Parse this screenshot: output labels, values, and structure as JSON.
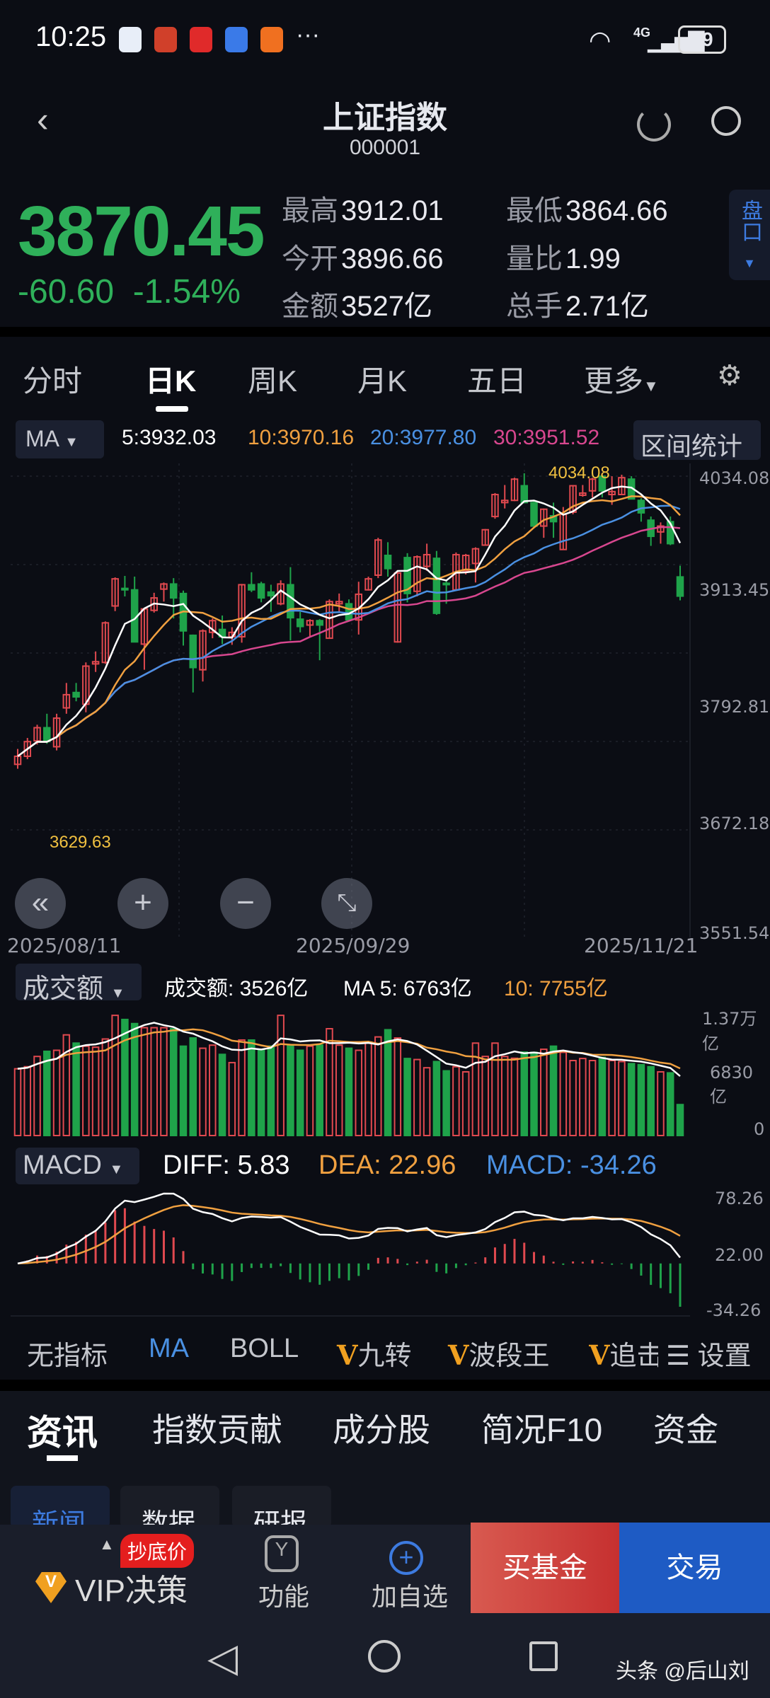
{
  "status_bar": {
    "time": "10:25",
    "more": "···",
    "network": "4G",
    "battery": "99"
  },
  "header": {
    "title": "上证指数",
    "code": "000001"
  },
  "quote": {
    "price": "3870.45",
    "change": "-60.60",
    "change_pct": "-1.54%",
    "stats": [
      {
        "label": "最高",
        "value": "3912.01"
      },
      {
        "label": "最低",
        "value": "3864.66"
      },
      {
        "label": "今开",
        "value": "3896.66"
      },
      {
        "label": "量比",
        "value": "1.99"
      },
      {
        "label": "金额",
        "value": "3527亿"
      },
      {
        "label": "总手",
        "value": "2.71亿"
      }
    ],
    "panel_button": "盘口"
  },
  "period_tabs": [
    "分时",
    "日K",
    "周K",
    "月K",
    "五日",
    "更多"
  ],
  "ma_bar": {
    "selector": "MA",
    "ma5": "5:3932.03",
    "ma10": "10:3970.16",
    "ma20": "20:3977.80",
    "ma30": "30:3951.52",
    "range_stats": "区间统计"
  },
  "colors": {
    "up": "#e0494f",
    "down": "#1fa34a",
    "ma5": "#ffffff",
    "ma10": "#f0a040",
    "ma20": "#4a90e2",
    "ma30": "#d8478f"
  },
  "chart_data": {
    "type": "candlestick",
    "y_ticks": [
      "4034.08",
      "3913.45",
      "3792.81",
      "3672.18",
      "3551.54"
    ],
    "ylim": [
      3551.54,
      4034.08
    ],
    "x_labels": [
      "2025/08/11",
      "2025/09/29",
      "2025/11/21"
    ],
    "annotations": {
      "high": "4034.08",
      "low": "3629.63"
    },
    "ohlc": [
      [
        3641,
        3662,
        3635,
        3652
      ],
      [
        3652,
        3677,
        3648,
        3672
      ],
      [
        3673,
        3695,
        3668,
        3691
      ],
      [
        3691,
        3710,
        3669,
        3672
      ],
      [
        3665,
        3710,
        3660,
        3704
      ],
      [
        3718,
        3752,
        3710,
        3736
      ],
      [
        3739,
        3752,
        3727,
        3733
      ],
      [
        3723,
        3780,
        3712,
        3775
      ],
      [
        3778,
        3795,
        3767,
        3781
      ],
      [
        3780,
        3836,
        3778,
        3834
      ],
      [
        3857,
        3896,
        3850,
        3894
      ],
      [
        3881,
        3898,
        3870,
        3879
      ],
      [
        3879,
        3897,
        3808,
        3808
      ],
      [
        3805,
        3854,
        3770,
        3853
      ],
      [
        3851,
        3875,
        3848,
        3868
      ],
      [
        3880,
        3889,
        3863,
        3887
      ],
      [
        3887,
        3895,
        3840,
        3868
      ],
      [
        3874,
        3878,
        3803,
        3823
      ],
      [
        3817,
        3818,
        3739,
        3773
      ],
      [
        3770,
        3825,
        3754,
        3823
      ],
      [
        3821,
        3840,
        3813,
        3837
      ],
      [
        3825,
        3844,
        3805,
        3815
      ],
      [
        3815,
        3828,
        3804,
        3821
      ],
      [
        3815,
        3887,
        3807,
        3886
      ],
      [
        3886,
        3903,
        3876,
        3879
      ],
      [
        3887,
        3890,
        3862,
        3868
      ],
      [
        3876,
        3886,
        3849,
        3871
      ],
      [
        3860,
        3892,
        3858,
        3887
      ],
      [
        3886,
        3910,
        3810,
        3841
      ],
      [
        3839,
        3849,
        3821,
        3829
      ],
      [
        3831,
        3839,
        3815,
        3837
      ],
      [
        3837,
        3839,
        3783,
        3831
      ],
      [
        3813,
        3866,
        3813,
        3863
      ],
      [
        3860,
        3874,
        3849,
        3863
      ],
      [
        3860,
        3866,
        3836,
        3838
      ],
      [
        3838,
        3890,
        3818,
        3873
      ],
      [
        3879,
        3897,
        3878,
        3894
      ],
      [
        3899,
        3950,
        3895,
        3947
      ],
      [
        3926,
        3944,
        3897,
        3908
      ],
      [
        3808,
        3905,
        3807,
        3902
      ],
      [
        3923,
        3929,
        3862,
        3874
      ],
      [
        3877,
        3926,
        3870,
        3924
      ],
      [
        3911,
        3942,
        3905,
        3927
      ],
      [
        3922,
        3932,
        3845,
        3847
      ],
      [
        3888,
        3892,
        3860,
        3887
      ],
      [
        3879,
        3930,
        3878,
        3927
      ],
      [
        3905,
        3928,
        3900,
        3926
      ],
      [
        3915,
        3937,
        3889,
        3935
      ],
      [
        3940,
        3962,
        3939,
        3961
      ],
      [
        3979,
        4011,
        3976,
        4009
      ],
      [
        3998,
        4022,
        3990,
        4001
      ],
      [
        4001,
        4032,
        4000,
        4030
      ],
      [
        4021,
        4038,
        3998,
        3998
      ],
      [
        3998,
        4000,
        3965,
        3966
      ],
      [
        3966,
        3990,
        3950,
        3989
      ],
      [
        3980,
        3998,
        3950,
        3972
      ],
      [
        3934,
        3992,
        3934,
        3982
      ],
      [
        3985,
        4022,
        3982,
        4021
      ],
      [
        4008,
        4022,
        4006,
        4011
      ],
      [
        4014,
        4032,
        4005,
        4030
      ],
      [
        4034,
        4034,
        4005,
        4014
      ],
      [
        4009,
        4034,
        3995,
        4013
      ],
      [
        4009,
        4036,
        4008,
        4032
      ],
      [
        4030,
        4034,
        4003,
        4003
      ],
      [
        4001,
        4004,
        3972,
        3984
      ],
      [
        3974,
        3979,
        3939,
        3952
      ],
      [
        3958,
        3971,
        3942,
        3966
      ],
      [
        3972,
        3979,
        3940,
        3942
      ],
      [
        3896.66,
        3912.01,
        3864.66,
        3870.45
      ]
    ],
    "volume": {
      "unit": "亿",
      "y_ticks": [
        "1.37万亿",
        "6830亿",
        "0"
      ],
      "ymax": 13700,
      "values": [
        7605,
        7839,
        9009,
        9594,
        9711,
        11466,
        10530,
        10179,
        10062,
        10998,
        13689,
        13221,
        12753,
        12285,
        12285,
        12285,
        12168,
        10179,
        11115,
        9945,
        10296,
        9243,
        8307,
        10881,
        10881,
        9711,
        10179,
        13689,
        10296,
        9711,
        10179,
        10296,
        12168,
        10296,
        9945,
        9711,
        10647,
        11232,
        12051,
        11115,
        8775,
        8658,
        7722,
        8424,
        7371,
        7839,
        7254,
        10530,
        9009,
        10530,
        9000,
        8800,
        9500,
        9477,
        9828,
        10179,
        9477,
        8541,
        8775,
        8541,
        8892,
        8541,
        8424,
        8190,
        8073,
        7839,
        7254,
        7137,
        3526
      ]
    },
    "macd": {
      "y_ticks": [
        "78.26",
        "22.00",
        "-34.26"
      ],
      "ylim": [
        -34.26,
        78.26
      ]
    }
  },
  "volume_bar": {
    "selector": "成交额",
    "amount": "成交额: 3526亿",
    "ma5": "MA 5: 6763亿",
    "ma10": "10: 7755亿"
  },
  "macd_bar": {
    "selector": "MACD",
    "diff": "DIFF: 5.83",
    "dea": "DEA: 22.96",
    "macd": "MACD: -34.26"
  },
  "indicators": {
    "items": [
      "无指标",
      "MA",
      "BOLL",
      "九转",
      "波段王",
      "追击"
    ],
    "settings": "设置",
    "vip_mark": "V"
  },
  "info_tabs": [
    "资讯",
    "指数贡献",
    "成分股",
    "简况F10",
    "资金"
  ],
  "sub_tabs": [
    "新闻",
    "数据",
    "研报"
  ],
  "bottom_bar": {
    "vip": "VIP决策",
    "badge": "抄底价",
    "func": "功能",
    "add": "加自选",
    "buy_fund": "买基金",
    "trade": "交易"
  },
  "watermark": "头条 @后山刘"
}
